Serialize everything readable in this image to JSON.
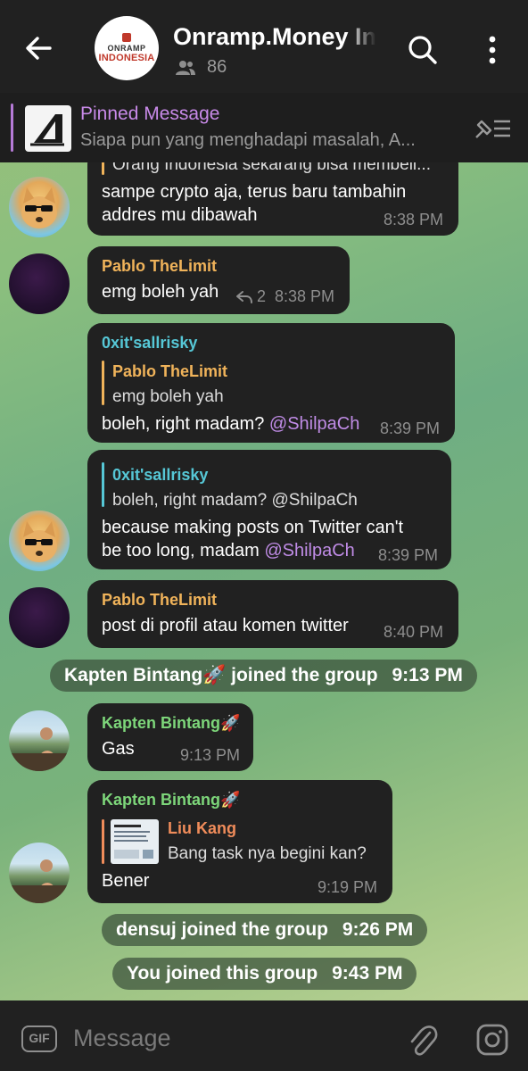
{
  "header": {
    "title": "Onramp.Money Indonesia",
    "member_count": "86",
    "logo_top": "ONRAMP",
    "logo_bottom": "INDONESIA"
  },
  "pinned": {
    "label": "Pinned Message",
    "preview": "Siapa pun yang menghadapi masalah, A..."
  },
  "messages": [
    {
      "quote_text": "Orang Indonesia sekarang bisa membeli...",
      "lines": [
        "sampe crypto aja, terus baru tambahin",
        "addres mu dibawah"
      ],
      "time": "8:38 PM"
    },
    {
      "sender": "Pablo TheLimit",
      "text": "emg boleh yah",
      "reply_count": "2",
      "time": "8:38 PM"
    },
    {
      "sender": "0xit'sallrisky",
      "quote_name": "Pablo TheLimit",
      "quote_text": "emg boleh yah",
      "text": "boleh, right madam?",
      "mention": "@ShilpaCh",
      "time": "8:39 PM"
    },
    {
      "quote_name": "0xit'sallrisky",
      "quote_text": "boleh, right madam? @ShilpaCh",
      "line1": "because making posts on Twitter can't",
      "line2": "be too long, madam",
      "mention": "@ShilpaCh",
      "time": "8:39 PM"
    },
    {
      "sender": "Pablo TheLimit",
      "text": "post di profil atau komen twitter",
      "time": "8:40 PM"
    },
    {
      "sender": "Kapten Bintang🚀",
      "text": "Gas",
      "time": "9:13 PM"
    },
    {
      "sender": "Kapten Bintang🚀",
      "quote_name": "Liu Kang",
      "quote_text": "Bang task nya begini kan?",
      "text": "Bener",
      "time": "9:19 PM"
    }
  ],
  "service": [
    {
      "text": "Kapten Bintang🚀 joined the group",
      "time": "9:13 PM"
    },
    {
      "text": "densuj joined the group",
      "time": "9:26 PM"
    },
    {
      "text": "You joined this group",
      "time": "9:43 PM"
    }
  ],
  "composer": {
    "gif_label": "GIF",
    "placeholder": "Message"
  },
  "colors": {
    "header_bg": "#212121",
    "bubble_bg": "#212121",
    "pinned_label": "#c88ae8",
    "mention": "#c08ce6",
    "name_pablo": "#f0b35a",
    "name_0xit": "#56c7d6",
    "name_kapten": "#7dd67a",
    "name_liu": "#f08c5a"
  },
  "icons": [
    "back-arrow-icon",
    "members-icon",
    "search-icon",
    "more-vertical-icon",
    "unpin-list-icon",
    "reply-icon",
    "gif-icon",
    "attach-icon",
    "instagram-icon"
  ]
}
